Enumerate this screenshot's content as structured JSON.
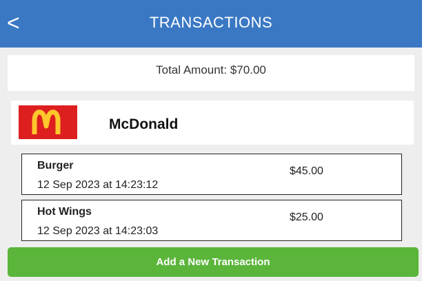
{
  "header": {
    "title": "TRANSACTIONS",
    "back_icon": "back-arrow-icon"
  },
  "summary": {
    "total_label": "Total Amount: $70.00"
  },
  "merchant": {
    "name": "McDonald",
    "logo": "mcdonalds-logo",
    "logo_color": "#dd1f1f",
    "logo_arch_color": "#ffc72c"
  },
  "transactions": [
    {
      "name": "Burger",
      "date": "12 Sep 2023 at 14:23:12",
      "amount": "$45.00"
    },
    {
      "name": "Hot Wings",
      "date": "12 Sep 2023 at 14:23:03",
      "amount": "$25.00"
    }
  ],
  "actions": {
    "add_label": "Add a New Transaction"
  },
  "colors": {
    "header": "#3a78c4",
    "add_button": "#5bb53b",
    "background": "#eeeeee"
  }
}
